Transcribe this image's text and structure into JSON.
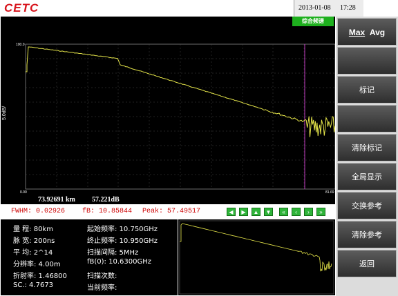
{
  "header": {
    "logo": "CETC",
    "date": "2013-01-08",
    "time": "17:28"
  },
  "screen": {
    "mode_badge": "综合频谱",
    "y_axis_label": "5.0dB/",
    "y_top_tick": "100.0",
    "x_left_tick": "0.00",
    "x_right_tick": "81.69",
    "marker_distance": "73.92691 km",
    "marker_level": "57.221dB"
  },
  "infobar": {
    "fwhm": "FWHM:  0.02926",
    "fb": "fB: 10.85844",
    "peak": "Peak: 57.49517"
  },
  "nav_buttons": [
    {
      "name": "left-arrow-icon",
      "glyph": "◀"
    },
    {
      "name": "right-arrow-icon",
      "glyph": "▶"
    },
    {
      "name": "up-arrow-icon",
      "glyph": "▲"
    },
    {
      "name": "down-arrow-icon",
      "glyph": "▼"
    },
    {
      "name": "fast-left-icon",
      "glyph": "«"
    },
    {
      "name": "step-left-icon",
      "glyph": "‹"
    },
    {
      "name": "step-right-icon",
      "glyph": "›"
    },
    {
      "name": "fast-right-icon",
      "glyph": "»"
    }
  ],
  "params": {
    "range": "量  程:  80km",
    "pulse": "脉  宽:  200ns",
    "average": "平  均:  2^14",
    "resolution": "分辨率:  4.00m",
    "refraction": "折射率:  1.46800",
    "sc": "SC.:   4.7673",
    "start_freq": "起始频率:  10.750GHz",
    "stop_freq": "终止频率:  10.950GHz",
    "scan_step": "扫描间隔:   5MHz",
    "fb0": "fB(0):  10.6300GHz",
    "scan_count": "扫描次数:",
    "current_freq": "当前频率:"
  },
  "softkeys": {
    "max": "Max",
    "avg": "Avg",
    "marker": "标记",
    "clear_marker": "清除标记",
    "full_display": "全局显示",
    "swap_ref": "交换参考",
    "clear_ref": "清除参考",
    "back": "返回"
  },
  "colors": {
    "trace": "#e6e64a",
    "marker_line": "#c23bc2",
    "badge": "#1eb01e",
    "info_text": "#cc0000",
    "softkey": "#3e3e3e"
  }
}
